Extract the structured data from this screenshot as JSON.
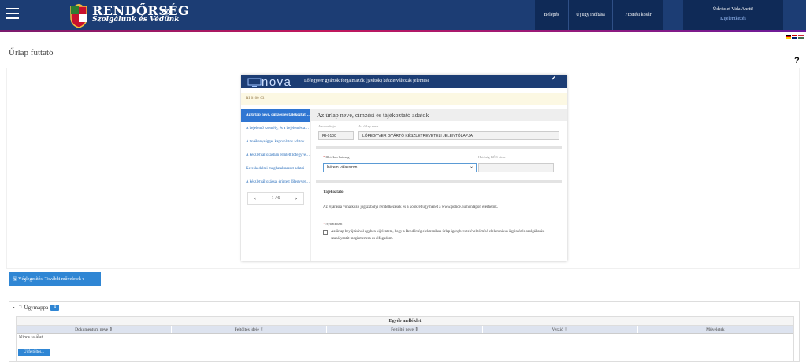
{
  "header": {
    "brand_title": "RENDŐRSÉG",
    "brand_subtitle": "Szolgálunk és Védünk",
    "nav": [
      "Belépés",
      "Új ügy indítása",
      "Fizetési kosár"
    ],
    "user_greeting": "Üdvözlet Vida Anett!",
    "logout_label": "Kijelentkezés",
    "colors": {
      "header_bg": "#1c3d74",
      "accent_stripe": "#c2185b"
    }
  },
  "page": {
    "title": "Űrlap futtató",
    "help_label": "?"
  },
  "form": {
    "logo_text": "nova",
    "header_title": "Lőfegyver gyártók/forgalmazók (javítók) készletváltozás jelentése",
    "form_code": "RI-0100-03",
    "sidebar_items": [
      "Az űrlap neve, címzési és tájékoztató adatok",
      "A bejelentő személy, és a bejelentés adatai",
      "A tevékenységgel kapcsolatos adatok",
      "A készletváltozásban érintett lőfegyverek",
      "Kereskedelmi meghatalmazott adatai",
      "A készletváltozással érintett lőfegyverek adatai"
    ],
    "pager": {
      "label": "1 / 6",
      "prev": "‹",
      "next": "›"
    },
    "section_title": "Az űrlap neve, címzési és tájékoztató adatok",
    "azonosito_label": "Azonosítója",
    "azonosito_value": "RI-0100",
    "urlap_neve_label": "Az űrlap neve",
    "urlap_neve_value": "LŐFEGYVER GYÁRTÓ KÉSZLETREVETELI JELENTŐLAPJA",
    "hatosag_label": "Illetékes hatóság",
    "hatosag_placeholder": "Kérem válasszon",
    "kr_label": "Hatóság KÉR címe",
    "info_title": "Tájékoztató",
    "info_text": "Az eljárásra vonatkozó jogszabályi rendelkezések és a konkrét ügymenet a www.police.hu honlapon elérhetők.",
    "decl_label": "Nyilatkozat",
    "decl_text": "Az űrlap beyújtásával egyben kijelentem, hogy a Rendőrség elektronikus űrlap igénybevételével történő elektronikus ügyintézés szolgáltatási szabályzatát megismertem és elfogadom."
  },
  "actions": {
    "finalize_label": "Véglegesítés",
    "more_label": "További műveletek"
  },
  "folder": {
    "title": "Ügymappa",
    "badge": "4",
    "table_title": "Egyéb melléklet",
    "columns": [
      "Dokumentum neve ⇕",
      "Feltöltés ideje ⇕",
      "Feltöltő neve ⇕",
      "Verzió ⇕",
      "Műveletek"
    ],
    "empty_text": "Nincs találat",
    "new_button": "Új feltöltés..."
  }
}
